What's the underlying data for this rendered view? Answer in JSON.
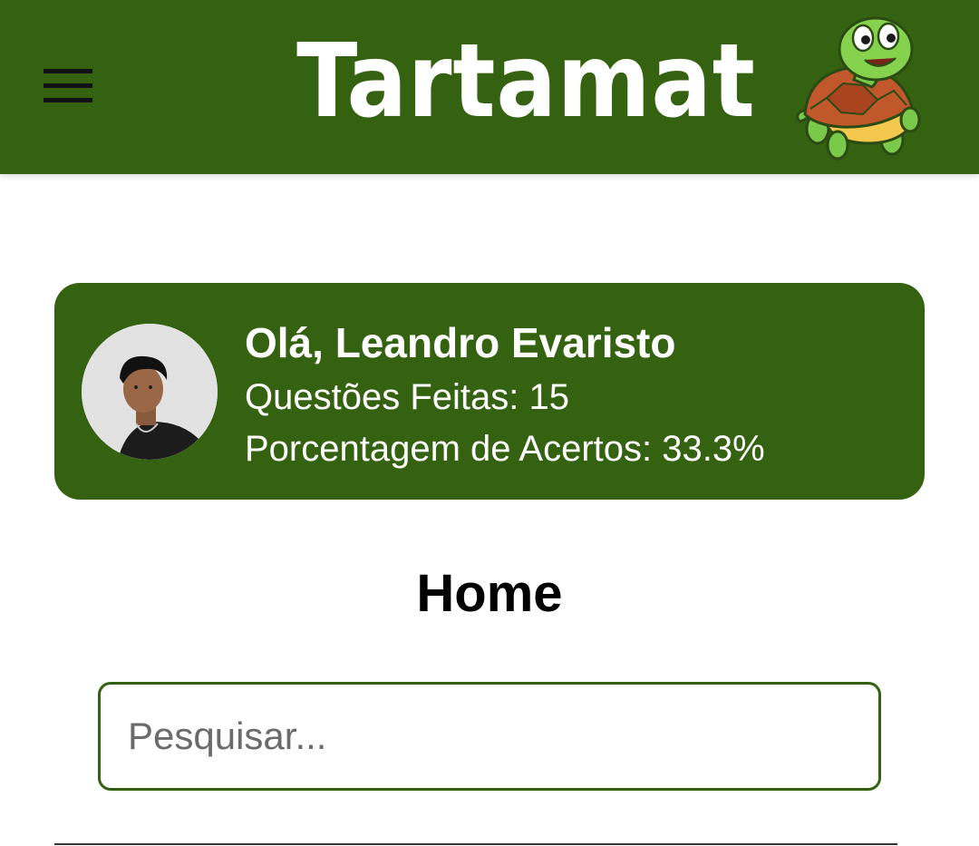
{
  "header": {
    "title": "Tartamat",
    "menu_icon": "hamburger-menu-icon",
    "mascot_icon": "turtle-mascot-icon",
    "background_color": "#356210"
  },
  "profile": {
    "greeting": "Olá, Leandro Evaristo",
    "questions_done": "Questões Feitas: 15",
    "accuracy": "Porcentagem de Acertos: 33.3%",
    "card_color": "#356210"
  },
  "main": {
    "page_title": "Home"
  },
  "search": {
    "placeholder": "Pesquisar...",
    "value": ""
  }
}
